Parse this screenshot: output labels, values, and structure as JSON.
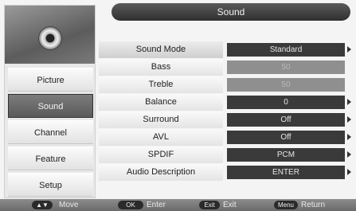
{
  "title": "Sound",
  "sidebar": {
    "icon": "speaker-icon",
    "items": [
      {
        "label": "Picture",
        "active": false
      },
      {
        "label": "Sound",
        "active": true
      },
      {
        "label": "Channel",
        "active": false
      },
      {
        "label": "Feature",
        "active": false
      },
      {
        "label": "Setup",
        "active": false
      }
    ]
  },
  "settings": [
    {
      "label": "Sound Mode",
      "value": "Standard",
      "state": "selected"
    },
    {
      "label": "Bass",
      "value": "50",
      "state": "disabled"
    },
    {
      "label": "Treble",
      "value": "50",
      "state": "disabled"
    },
    {
      "label": "Balance",
      "value": "0",
      "state": "normal"
    },
    {
      "label": "Surround",
      "value": "Off",
      "state": "normal"
    },
    {
      "label": "AVL",
      "value": "Off",
      "state": "normal"
    },
    {
      "label": "SPDIF",
      "value": "PCM",
      "state": "normal"
    },
    {
      "label": "Audio Description",
      "value": "ENTER",
      "state": "normal"
    }
  ],
  "hints": [
    {
      "key": "▲▼",
      "label": "Move"
    },
    {
      "key": "OK",
      "label": "Enter"
    },
    {
      "key": "Exit",
      "label": "Exit"
    },
    {
      "key": "Menu",
      "label": "Return"
    }
  ]
}
